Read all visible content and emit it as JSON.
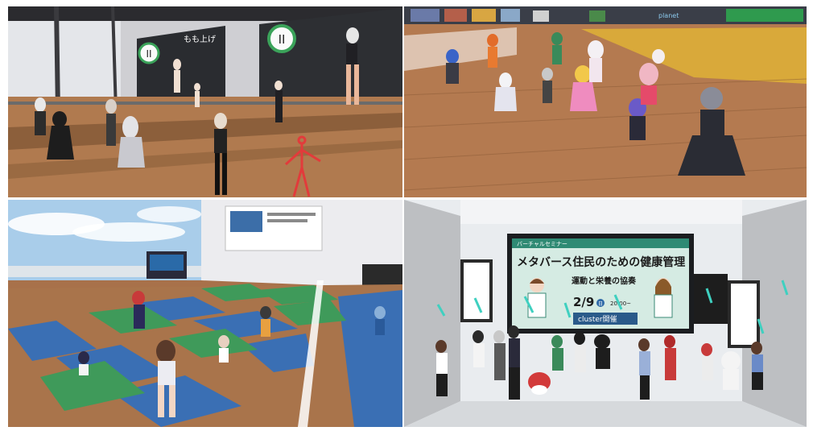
{
  "panels": {
    "studio": {
      "mirror_text": "もも上げ",
      "pause_glyph": "II"
    },
    "event": {
      "screen_label": "バーチャルセミナー",
      "title": "メタバース住民のための健康管理",
      "subtitle": "運動と栄養の協奏",
      "date": "2/9",
      "weekday": "日",
      "time": "20:00~",
      "venue": "cluster開催"
    }
  },
  "colors": {
    "floor_wood": "#b07a4f",
    "mat_green": "#3f9a5a",
    "mat_blue": "#3a6fb4",
    "sky": "#a9cdea",
    "yellow_floor": "#d9a93a",
    "screen_green": "#d5ebe3"
  }
}
